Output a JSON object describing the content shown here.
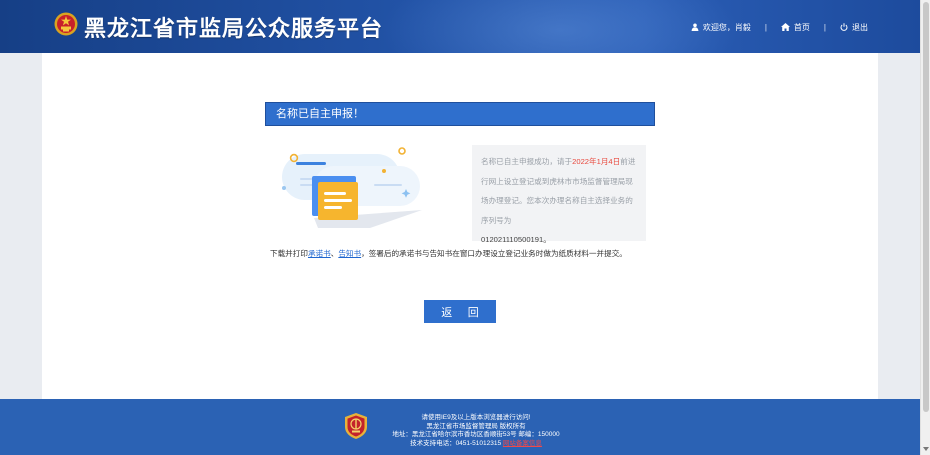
{
  "header": {
    "site_title": "黑龙江省市监局公众服务平台",
    "welcome_text": "欢迎您，肖毅",
    "home_label": "首页",
    "logout_label": "退出",
    "separator": "|"
  },
  "result": {
    "heading": "名称已自主申报！",
    "message_prefix": "名称已自主申报成功，请于",
    "deadline_date": "2022年1月4日",
    "message_suffix": "前进行网上设立登记或到虎林市市场监督管理局现场办理登记。您本次办理名称自主选择业务的序列号为",
    "serial_number": "012021110500191。"
  },
  "notice": {
    "prefix": "下载并打印",
    "commitment_link": "承诺书",
    "sep": "、",
    "notification_link": "告知书",
    "suffix": "，签署后的承诺书与告知书在窗口办理设立登记业务时做为纸质材料一并提交。"
  },
  "actions": {
    "back_label": "返 回"
  },
  "footer": {
    "line1": "请使用IE9及以上版本浏览器进行访问!",
    "line2": "黑龙江省市场监督管理局 版权所有",
    "line3": "地址：黑龙江省哈尔滨市香坊区香顺街53号 邮编：150000",
    "line4_prefix": "技术支持电话：0451-51012315",
    "line4_link": "网站备案信息"
  },
  "colors": {
    "header_blue": "#2253a7",
    "primary_button": "#2f6fcd",
    "date_highlight": "#e8483d",
    "link": "#1f66cf",
    "footer_blue": "#2b62b4"
  }
}
